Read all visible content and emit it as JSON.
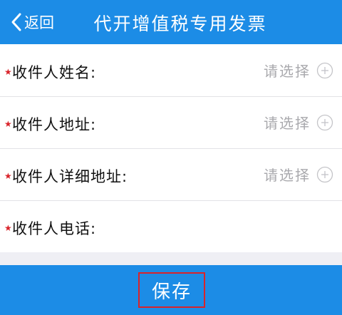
{
  "header": {
    "back_label": "返回",
    "title": "代开增值税专用发票"
  },
  "form": {
    "required_mark": "★",
    "fields": [
      {
        "label": "收件人姓名:",
        "placeholder": "请选择",
        "icon": "plus-circle-icon"
      },
      {
        "label": "收件人地址:",
        "placeholder": "请选择",
        "icon": "plus-circle-icon"
      },
      {
        "label": "收件人详细地址:",
        "placeholder": "请选择",
        "icon": "plus-circle-icon"
      },
      {
        "label": "收件人电话:"
      }
    ]
  },
  "footer": {
    "save_label": "保存"
  },
  "colors": {
    "brand": "#1c8ce6",
    "required": "#d9232a",
    "placeholder": "#a9a9ad",
    "highlight_border": "#d9232a"
  }
}
